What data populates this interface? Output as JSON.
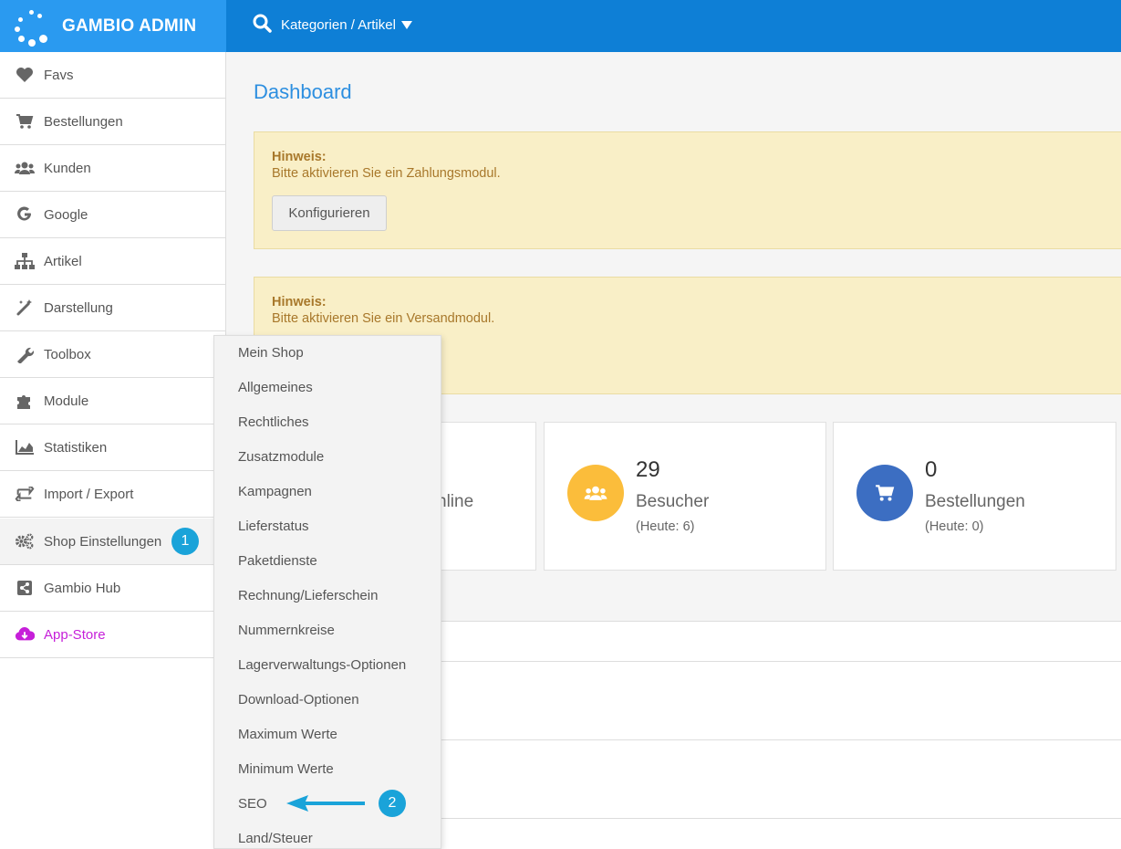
{
  "brand": {
    "title": "GAMBIO ADMIN"
  },
  "topbar": {
    "menu_label": "Kategorien / Artikel"
  },
  "sidebar": {
    "items": [
      {
        "label": "Favs",
        "icon": "heart-icon"
      },
      {
        "label": "Bestellungen",
        "icon": "cart-icon"
      },
      {
        "label": "Kunden",
        "icon": "users-icon"
      },
      {
        "label": "Google",
        "icon": "google-icon"
      },
      {
        "label": "Artikel",
        "icon": "sitemap-icon"
      },
      {
        "label": "Darstellung",
        "icon": "magic-wand-icon"
      },
      {
        "label": "Toolbox",
        "icon": "wrench-icon"
      },
      {
        "label": "Module",
        "icon": "puzzle-icon"
      },
      {
        "label": "Statistiken",
        "icon": "area-chart-icon"
      },
      {
        "label": "Import / Export",
        "icon": "exchange-icon"
      },
      {
        "label": "Shop Einstellungen",
        "icon": "gears-icon",
        "badge": "1"
      },
      {
        "label": "Gambio Hub",
        "icon": "share-icon"
      },
      {
        "label": "App-Store",
        "icon": "cloud-download-icon"
      }
    ]
  },
  "main": {
    "title": "Dashboard",
    "alerts": [
      {
        "title": "Hinweis:",
        "text": "Bitte aktivieren Sie ein Zahlungsmodul.",
        "button": "Konfigurieren"
      },
      {
        "title": "Hinweis:",
        "text": "Bitte aktivieren Sie ein Versandmodul."
      }
    ],
    "stats": [
      {
        "label_fragment": "nline"
      },
      {
        "number": "29",
        "label": "Besucher",
        "sub": "(Heute: 6)",
        "color": "#fbbd3b"
      },
      {
        "number": "0",
        "label": "Bestellungen",
        "sub": "(Heute: 0)",
        "color": "#3c6ec2"
      }
    ]
  },
  "dropdown": {
    "items": [
      "Mein Shop",
      "Allgemeines",
      "Rechtliches",
      "Zusatzmodule",
      "Kampagnen",
      "Lieferstatus",
      "Paketdienste",
      "Rechnung/Lieferschein",
      "Nummernkreise",
      "Lagerverwaltungs-Optionen",
      "Download-Optionen",
      "Maximum Werte",
      "Minimum Werte",
      "SEO",
      "Land/Steuer"
    ],
    "badge": "2"
  },
  "colors": {
    "topbar": "#0e7fd6",
    "brand": "#2a9af0",
    "accent": "#2d8fe0",
    "alert_bg": "#f9efc7",
    "badge": "#1aa3d9",
    "appstore": "#c61fd9"
  }
}
